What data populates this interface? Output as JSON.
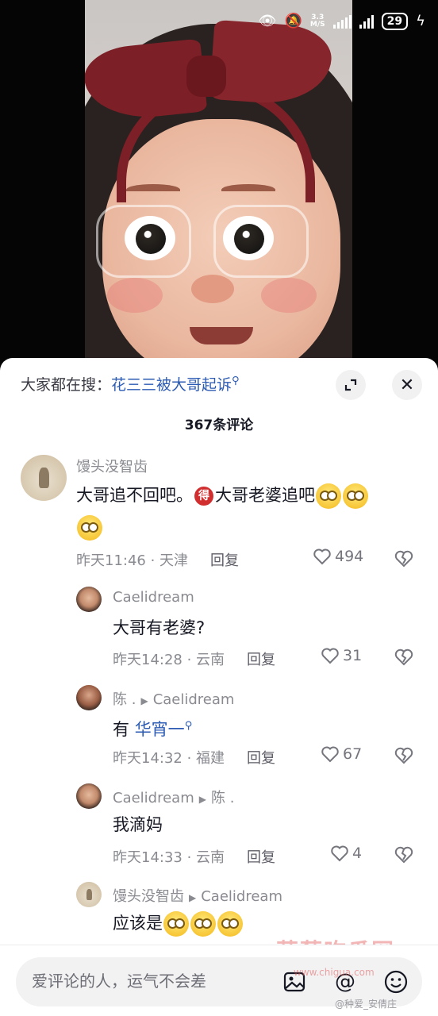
{
  "status_bar": {
    "speed": "3.3\nM/S",
    "battery": "29"
  },
  "sheet": {
    "search_prefix": "大家都在搜：",
    "search_keyword": "花三三被大哥起诉",
    "comment_count": "367条评论"
  },
  "comments": [
    {
      "user": "馒头没智齿",
      "text_a": "大哥追不回吧。",
      "badge": "得",
      "text_b": "大哥老婆追吧",
      "time": "昨天11:46 · 天津",
      "reply": "回复",
      "likes": "494"
    },
    {
      "user": "Caelidream",
      "text": "大哥有老婆?",
      "time": "昨天14:28 · 云南",
      "reply": "回复",
      "likes": "31"
    },
    {
      "user": "陈 .",
      "reply_to": "Caelidream",
      "text": "有",
      "keyword": "华宵一",
      "time": "昨天14:32 · 福建",
      "reply": "回复",
      "likes": "67"
    },
    {
      "user": "Caelidream",
      "reply_to": "陈 .",
      "text": "我滴妈",
      "time": "昨天14:33 · 云南",
      "reply": "回复",
      "likes": "4"
    },
    {
      "user": "馒头没智齿",
      "reply_to": "Caelidream",
      "text": "应该是"
    }
  ],
  "input": {
    "placeholder": "爱评论的人，运气不会差"
  },
  "watermark": {
    "big": "草莓吃瓜网",
    "small": "www.chigua.com",
    "weibo": "@种爱_安倩庄"
  },
  "icons": [
    "eye-icon",
    "mute-icon",
    "signal-icon",
    "battery-icon",
    "charging-icon",
    "expand-icon",
    "close-icon",
    "heart-icon",
    "broken-heart-icon",
    "image-icon",
    "at-icon",
    "emoji-icon"
  ]
}
